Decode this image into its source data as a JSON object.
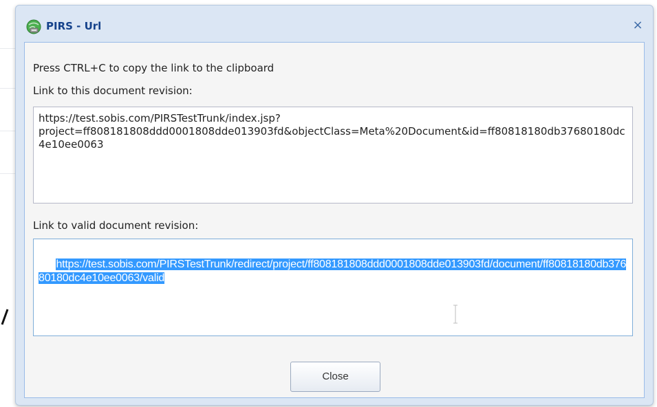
{
  "dialog": {
    "title": "PIRS - Url",
    "close_glyph": "×",
    "icon": "globe-link-icon"
  },
  "instructions": "Press CTRL+C to copy the link to the clipboard",
  "revision_link": {
    "label": "Link to this document revision:",
    "value": "https://test.sobis.com/PIRSTestTrunk/index.jsp?\nproject=ff808181808ddd0001808dde013903fd&objectClass=Meta%20Document&id=ff80818180db37680180dc4e10ee0063"
  },
  "valid_link": {
    "label": "Link to valid document revision:",
    "value": "https://test.sobis.com/PIRSTestTrunk/redirect/project/ff808181808ddd0001808dde013903fd/document/ff80818180db37680180dc4e10ee0063/valid"
  },
  "buttons": {
    "close_label": "Close"
  },
  "colors": {
    "title_text": "#15428b",
    "selection": "#3399ff",
    "dialog_frame": "#dbe6f4"
  }
}
